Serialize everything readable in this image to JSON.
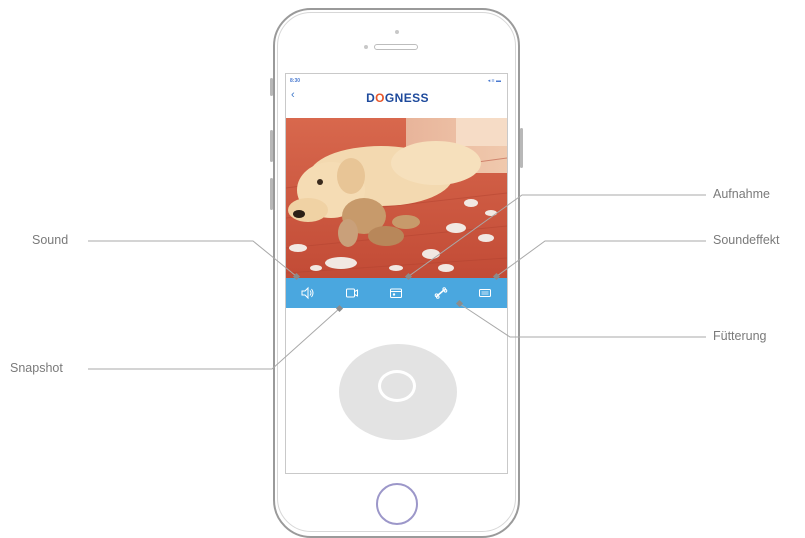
{
  "status_bar": {
    "time": "8:30",
    "icons": "◂ ≡ ▬"
  },
  "app": {
    "logo": "DOGNESS",
    "back": "‹"
  },
  "toolbar": {
    "buttons": [
      {
        "icon": "speaker-icon"
      },
      {
        "icon": "camera-icon"
      },
      {
        "icon": "record-icon"
      },
      {
        "icon": "bone-icon"
      },
      {
        "icon": "sound-effect-icon"
      }
    ]
  },
  "callouts": {
    "sound": "Sound",
    "snapshot": "Snapshot",
    "aufnahme": "Aufnahme",
    "soundeffekt": "Soundeffekt",
    "fuetterung": "Fütterung"
  },
  "colors": {
    "toolbar": "#4aa7df",
    "logo": "#1e4a9c",
    "home_button": "#9c97c9",
    "callout_text": "#7a7a7a"
  }
}
